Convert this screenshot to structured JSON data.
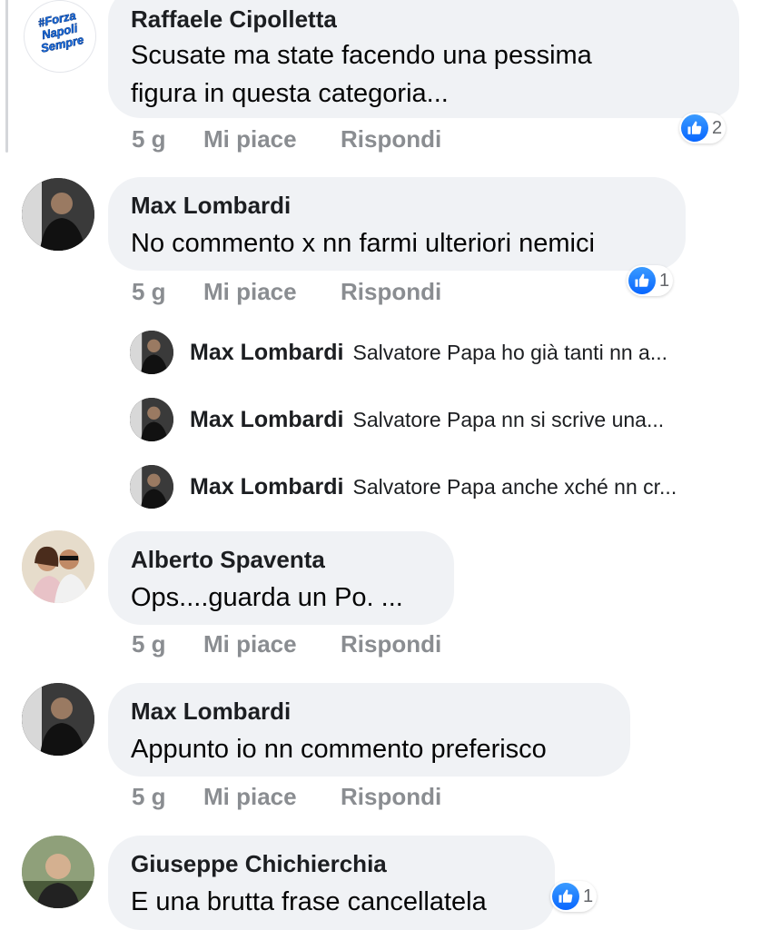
{
  "comments": [
    {
      "author": "Raffaele Cipolletta",
      "lines": [
        "Scusate ma state facendo una pessima",
        "figura in questa categoria..."
      ],
      "time": "5 g",
      "like_label": "Mi piace",
      "reply_label": "Rispondi",
      "reactions": "2",
      "avatar_text": [
        "#Forza",
        "Napoli",
        "Sempre"
      ]
    },
    {
      "author": "Max Lombardi",
      "lines": [
        "No commento x nn farmi ulteriori nemici"
      ],
      "time": "5 g",
      "like_label": "Mi piace",
      "reply_label": "Rispondi",
      "reactions": "1"
    },
    {
      "author": "Alberto Spaventa",
      "lines": [
        "Ops....guarda un Po. ..."
      ],
      "time": "5 g",
      "like_label": "Mi piace",
      "reply_label": "Rispondi"
    },
    {
      "author": "Max Lombardi",
      "lines": [
        "Appunto io nn commento preferisco"
      ],
      "time": "5 g",
      "like_label": "Mi piace",
      "reply_label": "Rispondi"
    },
    {
      "author": "Giuseppe Chichierchia",
      "lines": [
        "E una brutta frase cancellatela"
      ],
      "reactions": "1"
    }
  ],
  "replies": [
    {
      "author": "Max Lombardi",
      "text": "Salvatore Papa ho già tanti nn a..."
    },
    {
      "author": "Max Lombardi",
      "text": "Salvatore Papa nn si scrive una..."
    },
    {
      "author": "Max Lombardi",
      "text": "Salvatore Papa anche xché nn cr..."
    }
  ],
  "colors": {
    "like_blue": "#0866ff",
    "bubble": "#f0f2f5",
    "meta_gray": "#8a8d91"
  }
}
